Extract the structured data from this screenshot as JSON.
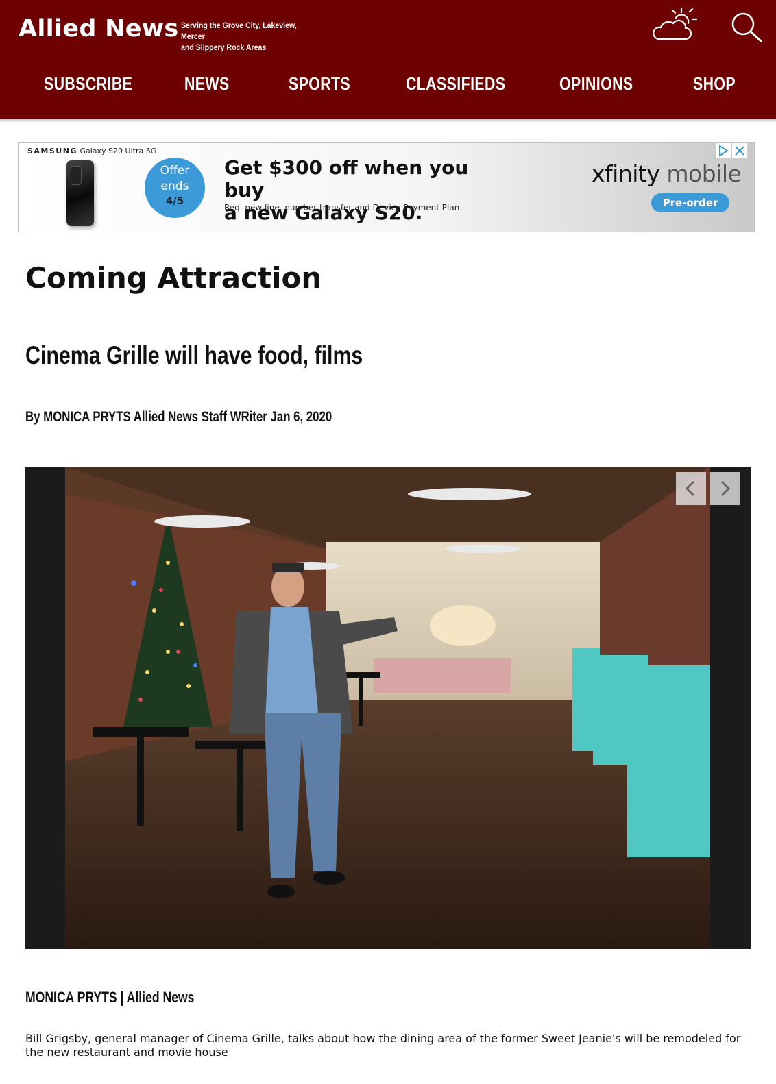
{
  "header": {
    "logo": "Allied News",
    "tagline_line1": "Serving the Grove City, Lakeview, Mercer",
    "tagline_line2": "and Slippery Rock Areas",
    "weather_icon": "weather-partly-cloudy-icon",
    "search_icon": "search-icon",
    "background_color": "#6e0202"
  },
  "nav": {
    "items": [
      {
        "label": "SUBSCRIBE"
      },
      {
        "label": "NEWS"
      },
      {
        "label": "SPORTS"
      },
      {
        "label": "CLASSIFIEDS"
      },
      {
        "label": "OPINIONS"
      },
      {
        "label": "SHOP"
      }
    ]
  },
  "ad": {
    "brand": "SAMSUNG",
    "product": "Galaxy S20 Ultra 5G",
    "offer_line1": "Offer",
    "offer_line2": "ends",
    "offer_date": "4/5",
    "headline_line1": "Get $300 off when you buy",
    "headline_line2": "a new Galaxy S20.",
    "fine_print": "Req. new line, number transfer and Device Payment Plan",
    "advertiser_a": "xfinity",
    "advertiser_b": "mobile",
    "cta": "Pre-order",
    "accent_color": "#3d9ad8"
  },
  "article": {
    "section_title": "Coming Attraction",
    "headline": "Cinema Grille will have food, films",
    "byline": "By MONICA PRYTS Allied News Staff WRiter Jan 6, 2020",
    "photo_credit": "MONICA PRYTS | Allied News",
    "caption": "Bill Grigsby, general manager of Cinema Grille, talks about how the dining area of the former Sweet Jeanie's will be remodeled for the new restaurant and movie house"
  }
}
